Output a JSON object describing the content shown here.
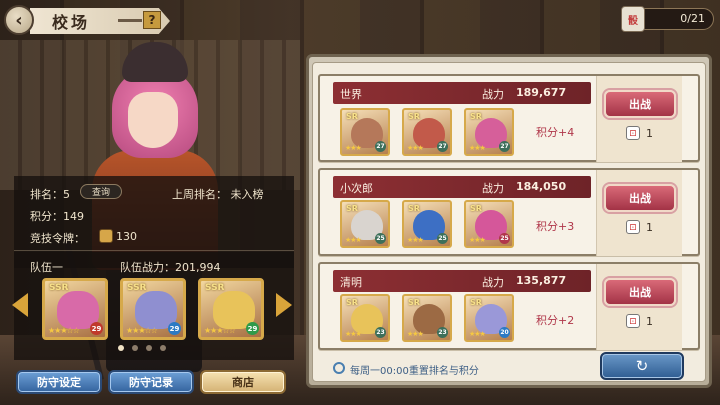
{
  "header": {
    "title": "校场",
    "help_label": "?",
    "back_label": "‹",
    "resource_count": "0/21",
    "resource_icon_text": "骰"
  },
  "player": {
    "rank_label": "排名：",
    "rank_value": "5",
    "query_label": "查询",
    "last_week_label": "上周排名：",
    "last_week_value": "未入榜",
    "score_label": "积分：",
    "score_value": "149",
    "token_label": "竞技令牌：",
    "token_value": "130"
  },
  "team": {
    "label": "队伍一",
    "power_label": "队伍战力：",
    "power_value": "201,994",
    "members": [
      {
        "level": "29",
        "stars": "★★★☆☆",
        "rarity": "SSR",
        "hair": "#d86aa8"
      },
      {
        "level": "29",
        "stars": "★★★☆☆",
        "rarity": "SSR",
        "hair": "#8f8fd0"
      },
      {
        "level": "29",
        "stars": "★★★☆☆",
        "rarity": "SSR",
        "hair": "#e8c35a"
      }
    ]
  },
  "buttons": {
    "defense_setup": "防守设定",
    "defense_log": "防守记录",
    "shop": "商店",
    "refresh": "↻"
  },
  "opponents": [
    {
      "name": "世界",
      "power_label": "战力",
      "power": "189,677",
      "score": "积分+4",
      "fight_label": "出战",
      "dice_count": "1",
      "heroes": [
        {
          "level": "27",
          "stars": "★★★",
          "rarity": "SR",
          "hair": "#b5785a"
        },
        {
          "level": "27",
          "stars": "★★★",
          "rarity": "SR",
          "hair": "#c25a4a"
        },
        {
          "level": "27",
          "stars": "★★★",
          "rarity": "SR",
          "hair": "#d65f9a"
        }
      ]
    },
    {
      "name": "小次郎",
      "power_label": "战力",
      "power": "184,050",
      "score": "积分+3",
      "fight_label": "出战",
      "dice_count": "1",
      "heroes": [
        {
          "level": "25",
          "stars": "★★★",
          "rarity": "SR",
          "hair": "#d9d4cf"
        },
        {
          "level": "25",
          "stars": "★★★",
          "rarity": "SR",
          "hair": "#3d6fc4"
        },
        {
          "level": "25",
          "stars": "★★★",
          "rarity": "SR",
          "hair": "#d5579a"
        }
      ]
    },
    {
      "name": "清明",
      "power_label": "战力",
      "power": "135,877",
      "score": "积分+2",
      "fight_label": "出战",
      "dice_count": "1",
      "heroes": [
        {
          "level": "23",
          "stars": "★★★",
          "rarity": "SR",
          "hair": "#e8c35a"
        },
        {
          "level": "23",
          "stars": "★★★",
          "rarity": "SR",
          "hair": "#9c6a44"
        },
        {
          "level": "20",
          "stars": "★★★",
          "rarity": "SR",
          "hair": "#9a98d8"
        }
      ]
    }
  ],
  "reset_note": "每周一00:00重置排名与积分",
  "colors": {
    "accent_red": "#8d2f33",
    "fight_pink": "#d96a78",
    "gold": "#d6a94a",
    "blue_button": "#34639e"
  }
}
